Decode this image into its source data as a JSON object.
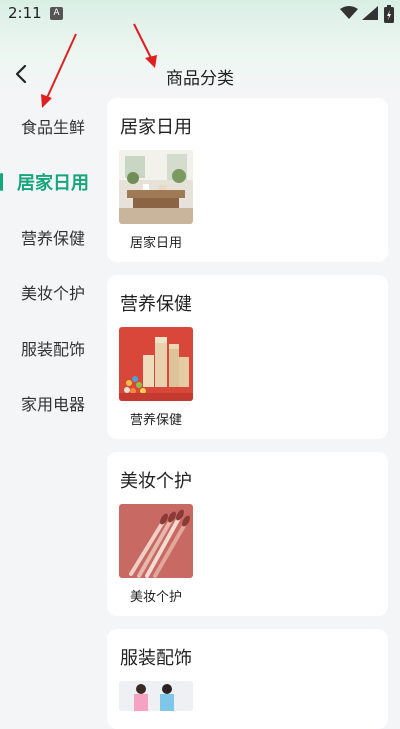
{
  "status_bar": {
    "time": "2:11",
    "notification_letter": "A"
  },
  "header": {
    "title": "商品分类"
  },
  "sidebar": {
    "items": [
      {
        "label": "食品生鲜",
        "active": false
      },
      {
        "label": "居家日用",
        "active": true
      },
      {
        "label": "营养保健",
        "active": false
      },
      {
        "label": "美妆个护",
        "active": false
      },
      {
        "label": "服装配饰",
        "active": false
      },
      {
        "label": "家用电器",
        "active": false
      }
    ]
  },
  "sections": [
    {
      "title": "居家日用",
      "items": [
        {
          "label": "居家日用",
          "image": "living-room-image"
        }
      ]
    },
    {
      "title": "营养保健",
      "items": [
        {
          "label": "营养保健",
          "image": "supplements-image"
        }
      ]
    },
    {
      "title": "美妆个护",
      "items": [
        {
          "label": "美妆个护",
          "image": "makeup-brushes-image"
        }
      ]
    },
    {
      "title": "服装配饰",
      "items": [
        {
          "label": "",
          "image": "fashion-image"
        }
      ]
    }
  ],
  "colors": {
    "accent": "#17a57a",
    "annotation_arrow": "#e02020",
    "background": "#f4f5f7"
  }
}
